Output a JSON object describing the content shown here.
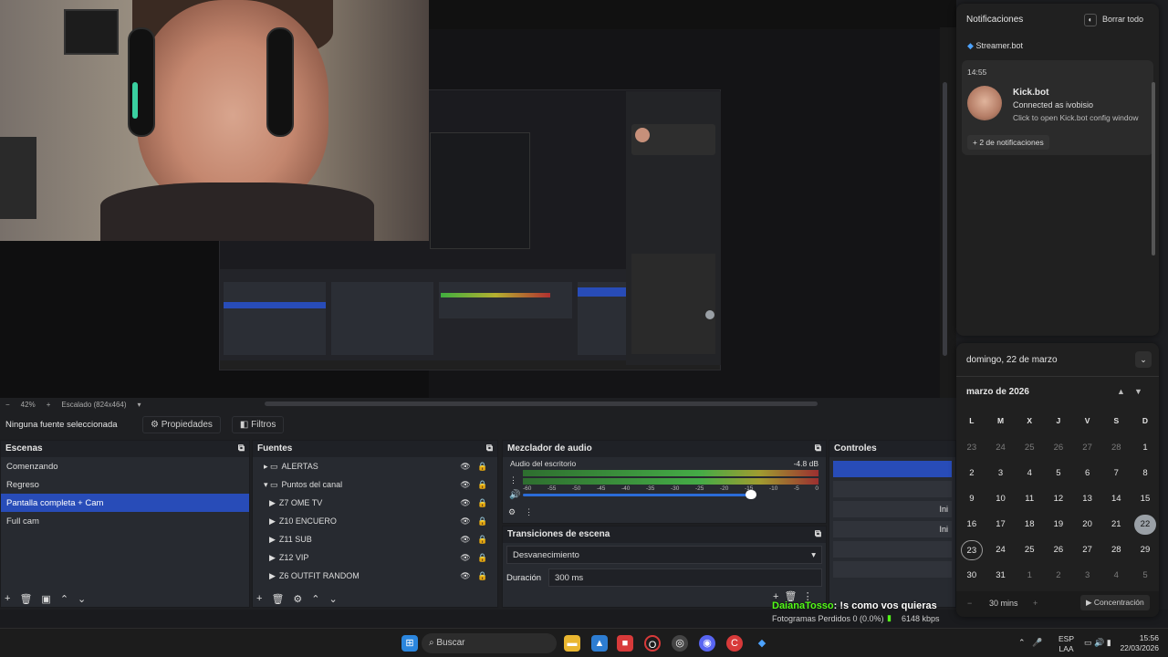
{
  "preview": {
    "zoom": "42%",
    "scale_label": "Escalado (824x464)"
  },
  "toolbar": {
    "no_source": "Ninguna fuente seleccionada",
    "properties": "Propiedades",
    "filters": "Filtros"
  },
  "scenes": {
    "title": "Escenas",
    "items": [
      "Comenzando",
      "Regreso",
      "Pantalla completa + Cam",
      "Full cam"
    ],
    "selected_index": 2
  },
  "sources": {
    "title": "Fuentes",
    "items": [
      {
        "label": "ALERTAS",
        "indent": 0,
        "folder": true
      },
      {
        "label": "Puntos del  canal",
        "indent": 0,
        "folder": true
      },
      {
        "label": "Z7 OME TV",
        "indent": 1
      },
      {
        "label": "Z10 ENCUERO",
        "indent": 1
      },
      {
        "label": "Z11 SUB",
        "indent": 1
      },
      {
        "label": "Z12 VIP",
        "indent": 1
      },
      {
        "label": "Z6 OUTFIT RANDOM",
        "indent": 1
      }
    ]
  },
  "mixer": {
    "title": "Mezclador de audio",
    "channel": "Audio del escritorio",
    "db": "-4.8 dB",
    "ticks": [
      "-60",
      "-55",
      "-50",
      "-45",
      "-40",
      "-35",
      "-30",
      "-25",
      "-20",
      "-15",
      "-10",
      "-5",
      "0"
    ]
  },
  "transitions": {
    "title": "Transiciones de escena",
    "selected": "Desvanecimiento",
    "duration_label": "Duración",
    "duration_value": "300 ms"
  },
  "controls": {
    "title": "Controles",
    "partial1": "Ini",
    "partial2": "Ini"
  },
  "notifications": {
    "title": "Notificaciones",
    "clear_all": "Borrar todo",
    "app": "Streamer.bot",
    "time": "14:55",
    "card_title": "Kick.bot",
    "card_line1": "Connected as ivobisio",
    "card_line2": "Click to open Kick.bot config window",
    "more": "+ 2 de notificaciones"
  },
  "calendar": {
    "date_header": "domingo, 22 de marzo",
    "month": "marzo de 2026",
    "weekdays": [
      "L",
      "M",
      "X",
      "J",
      "V",
      "S",
      "D"
    ],
    "days": [
      {
        "d": "23",
        "m": true
      },
      {
        "d": "24",
        "m": true
      },
      {
        "d": "25",
        "m": true
      },
      {
        "d": "26",
        "m": true
      },
      {
        "d": "27",
        "m": true
      },
      {
        "d": "28",
        "m": true
      },
      {
        "d": "1"
      },
      {
        "d": "2"
      },
      {
        "d": "3"
      },
      {
        "d": "4"
      },
      {
        "d": "5"
      },
      {
        "d": "6"
      },
      {
        "d": "7"
      },
      {
        "d": "8"
      },
      {
        "d": "9"
      },
      {
        "d": "10"
      },
      {
        "d": "11"
      },
      {
        "d": "12"
      },
      {
        "d": "13"
      },
      {
        "d": "14"
      },
      {
        "d": "15"
      },
      {
        "d": "16"
      },
      {
        "d": "17"
      },
      {
        "d": "18"
      },
      {
        "d": "19"
      },
      {
        "d": "20"
      },
      {
        "d": "21"
      },
      {
        "d": "22",
        "today": true
      },
      {
        "d": "23",
        "ring": true
      },
      {
        "d": "24"
      },
      {
        "d": "25"
      },
      {
        "d": "26"
      },
      {
        "d": "27"
      },
      {
        "d": "28"
      },
      {
        "d": "29"
      },
      {
        "d": "30"
      },
      {
        "d": "31"
      },
      {
        "d": "1",
        "m": true
      },
      {
        "d": "2",
        "m": true
      },
      {
        "d": "3",
        "m": true
      },
      {
        "d": "4",
        "m": true
      },
      {
        "d": "5",
        "m": true
      }
    ],
    "focus_minus": "−",
    "focus_time": "30 mins",
    "focus_plus": "+",
    "focus_label": "Concentración"
  },
  "status": {
    "dropped": "Fotogramas Perdidos 0 (0.0%)",
    "kbps": "6148 kbps"
  },
  "chat": {
    "user": "DaianaTosso",
    "message": ": !s como vos quieras"
  },
  "taskbar": {
    "search": "Buscar",
    "lang1": "ESP",
    "lang2": "LAA",
    "time": "15:56",
    "date": "22/03/2026"
  },
  "colors": {
    "accent": "#284cb8",
    "today_bg": "#9aa0a6",
    "chat_user": "#53fc18"
  }
}
